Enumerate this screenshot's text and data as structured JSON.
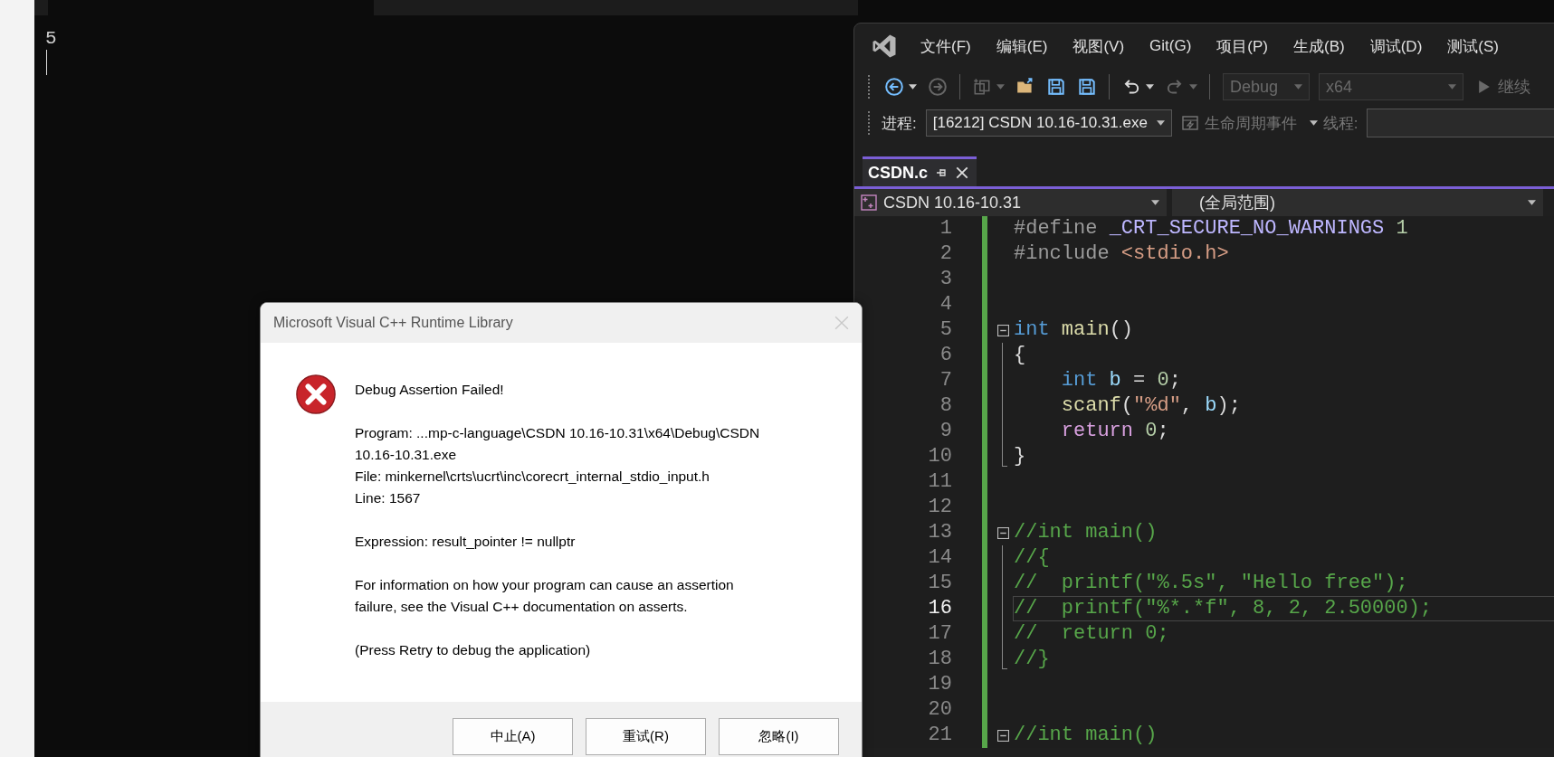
{
  "console": {
    "output": "5"
  },
  "vs": {
    "menu": [
      "文件(F)",
      "编辑(E)",
      "视图(V)",
      "Git(G)",
      "项目(P)",
      "生成(B)",
      "调试(D)",
      "测试(S)"
    ],
    "toolbar": [
      {
        "kind": "back",
        "disabled": false,
        "caret": true
      },
      {
        "kind": "forward",
        "disabled": true,
        "caret": false
      },
      {
        "kind": "sep"
      },
      {
        "kind": "new",
        "disabled": true,
        "caret": true
      },
      {
        "kind": "open",
        "disabled": false,
        "caret": false
      },
      {
        "kind": "save",
        "disabled": false,
        "caret": false
      },
      {
        "kind": "saveall",
        "disabled": false,
        "caret": false
      },
      {
        "kind": "sep"
      },
      {
        "kind": "undo",
        "disabled": false,
        "caret": true
      },
      {
        "kind": "redo",
        "disabled": true,
        "caret": true
      },
      {
        "kind": "sep"
      }
    ],
    "configs": [
      {
        "value": "Debug",
        "disabled": true
      },
      {
        "value": "x64",
        "disabled": true
      }
    ],
    "continue": {
      "label": "继续",
      "disabled": true
    },
    "process_label": "进程:",
    "process": "[16212] CSDN 10.16-10.31.exe",
    "lifecycle": "生命周期事件",
    "thread_label": "线程:",
    "tabs": [
      {
        "label": "CSDN.c",
        "selected": true
      }
    ],
    "scope_project": "CSDN 10.16-10.31",
    "scope": "(全局范围)",
    "lines": [
      {
        "number": "1",
        "collapsible": false,
        "in_block": false,
        "current": false,
        "tokens": [
          {
            "kind": "pp",
            "text": "#define "
          },
          {
            "kind": "macro",
            "text": "_CRT_SECURE_NO_WARNINGS"
          },
          {
            "kind": "num",
            "text": " 1"
          }
        ]
      },
      {
        "number": "2",
        "collapsible": false,
        "in_block": false,
        "current": false,
        "tokens": [
          {
            "kind": "pp",
            "text": "#include "
          },
          {
            "kind": "str",
            "text": "<stdio.h>"
          }
        ]
      },
      {
        "number": "3",
        "collapsible": false,
        "in_block": false,
        "current": false
      },
      {
        "number": "4",
        "collapsible": false,
        "in_block": false,
        "current": false
      },
      {
        "number": "5",
        "collapsible": true,
        "in_block": false,
        "current": false,
        "tokens": [
          {
            "kind": "kw",
            "text": "int"
          },
          {
            "kind": "fn",
            "text": " main"
          },
          {
            "kind": "plain",
            "text": "()"
          }
        ]
      },
      {
        "number": "6",
        "collapsible": false,
        "in_block": true,
        "block_end": false,
        "current": false,
        "tokens": [
          {
            "kind": "plain",
            "text": "{"
          }
        ]
      },
      {
        "number": "7",
        "collapsible": false,
        "in_block": true,
        "block_end": false,
        "current": false,
        "tokens": [
          {
            "kind": "kw",
            "text": "    int"
          },
          {
            "kind": "var",
            "text": " b"
          },
          {
            "kind": "plain",
            "text": " = "
          },
          {
            "kind": "num",
            "text": "0"
          },
          {
            "kind": "plain",
            "text": ";"
          }
        ]
      },
      {
        "number": "8",
        "collapsible": false,
        "in_block": true,
        "block_end": false,
        "current": false,
        "tokens": [
          {
            "kind": "fn",
            "text": "    scanf"
          },
          {
            "kind": "plain",
            "text": "("
          },
          {
            "kind": "str",
            "text": "\"%d\""
          },
          {
            "kind": "plain",
            "text": ", "
          },
          {
            "kind": "var",
            "text": "b"
          },
          {
            "kind": "plain",
            "text": ");"
          }
        ]
      },
      {
        "number": "9",
        "collapsible": false,
        "in_block": true,
        "block_end": false,
        "current": false,
        "tokens": [
          {
            "kind": "ctl",
            "text": "    return"
          },
          {
            "kind": "num",
            "text": " 0"
          },
          {
            "kind": "plain",
            "text": ";"
          }
        ]
      },
      {
        "number": "10",
        "collapsible": false,
        "in_block": true,
        "block_end": true,
        "current": false,
        "tokens": [
          {
            "kind": "plain",
            "text": "}"
          }
        ]
      },
      {
        "number": "11",
        "collapsible": false,
        "in_block": false,
        "current": false
      },
      {
        "number": "12",
        "collapsible": false,
        "in_block": false,
        "current": false
      },
      {
        "number": "13",
        "collapsible": true,
        "in_block": false,
        "current": false,
        "tokens": [
          {
            "kind": "cmt",
            "text": "//int main()"
          }
        ]
      },
      {
        "number": "14",
        "collapsible": false,
        "in_block": true,
        "block_end": false,
        "current": false,
        "tokens": [
          {
            "kind": "cmt",
            "text": "//{"
          }
        ]
      },
      {
        "number": "15",
        "collapsible": false,
        "in_block": true,
        "block_end": false,
        "current": false,
        "tokens": [
          {
            "kind": "cmt",
            "text": "//  printf(\"%.5s\", \"Hello free\");"
          }
        ]
      },
      {
        "number": "16",
        "collapsible": false,
        "in_block": true,
        "block_end": false,
        "current": true,
        "tokens": [
          {
            "kind": "cmt",
            "text": "//  printf(\"%*.*f\", 8, 2, 2.50000);"
          }
        ]
      },
      {
        "number": "17",
        "collapsible": false,
        "in_block": true,
        "block_end": false,
        "current": false,
        "tokens": [
          {
            "kind": "cmt",
            "text": "//  return 0;"
          }
        ]
      },
      {
        "number": "18",
        "collapsible": false,
        "in_block": true,
        "block_end": true,
        "current": false,
        "tokens": [
          {
            "kind": "cmt",
            "text": "//}"
          }
        ]
      },
      {
        "number": "19",
        "collapsible": false,
        "in_block": false,
        "current": false
      },
      {
        "number": "20",
        "collapsible": false,
        "in_block": false,
        "current": false
      },
      {
        "number": "21",
        "collapsible": true,
        "in_block": false,
        "current": false,
        "tokens": [
          {
            "kind": "cmt",
            "text": "//int main()"
          }
        ]
      }
    ]
  },
  "dialog": {
    "title": "Microsoft Visual C++ Runtime Library",
    "heading": "Debug Assertion Failed!",
    "paragraphs": [
      [
        "Program: ...mp-c-language\\CSDN 10.16-10.31\\x64\\Debug\\CSDN",
        "10.16-10.31.exe",
        "File: minkernel\\crts\\ucrt\\inc\\corecrt_internal_stdio_input.h",
        "Line: 1567"
      ],
      [
        "Expression: result_pointer != nullptr"
      ],
      [
        "For information on how your program can cause an assertion",
        "failure, see the Visual C++ documentation on asserts."
      ],
      [
        "(Press Retry to debug the application)"
      ]
    ],
    "buttons": [
      "中止(A)",
      "重试(R)",
      "忽略(I)"
    ]
  }
}
